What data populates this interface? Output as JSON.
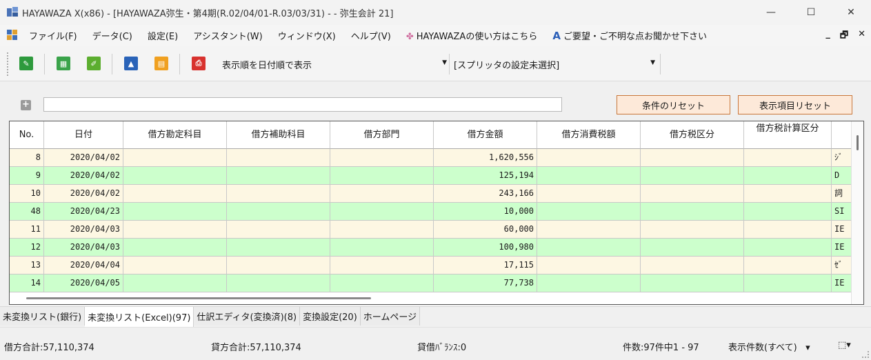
{
  "window": {
    "title": "HAYAWAZA X(x86) - [HAYAWAZA弥生・第4期(R.02/04/01-R.03/03/31) -  - 弥生会計 21]",
    "minimize": "—",
    "maximize": "☐",
    "close": "✕"
  },
  "menu": {
    "items": [
      "ファイル(F)",
      "データ(C)",
      "設定(E)",
      "アシスタント(W)",
      "ウィンドウ(X)",
      "ヘルプ(V)"
    ],
    "howto": "HAYAWAZAの使い方はこちら",
    "feedback": "ご要望・ご不明な点お聞かせ下さい",
    "mdi_min": "_",
    "mdi_restore": "🗗",
    "mdi_close": "✕"
  },
  "toolbar": {
    "sort_select": "表示順を日付順で表示",
    "splitter_select": "[スプリッタの設定未選択]",
    "icons": [
      "new-doc-icon",
      "spreadsheet-icon",
      "edit-icon",
      "upload-icon",
      "document-icon",
      "excel-export-icon"
    ]
  },
  "filter": {
    "expand": "+",
    "value": "",
    "reset_conditions": "条件のリセット",
    "reset_columns": "表示項目リセット"
  },
  "table": {
    "headers": [
      "No.",
      "日付",
      "借方勘定科目",
      "借方補助科目",
      "借方部門",
      "借方金額",
      "借方消費税額",
      "借方税区分",
      "借方税計算区分",
      ""
    ],
    "rows": [
      {
        "no": "8",
        "date": "2020/04/02",
        "amount": "1,620,556",
        "extra": "ｼﾞ"
      },
      {
        "no": "9",
        "date": "2020/04/02",
        "amount": "125,194",
        "extra": "D"
      },
      {
        "no": "10",
        "date": "2020/04/02",
        "amount": "243,166",
        "extra": "詞"
      },
      {
        "no": "48",
        "date": "2020/04/23",
        "amount": "10,000",
        "extra": "SI"
      },
      {
        "no": "11",
        "date": "2020/04/03",
        "amount": "60,000",
        "extra": "IE"
      },
      {
        "no": "12",
        "date": "2020/04/03",
        "amount": "100,980",
        "extra": "IE"
      },
      {
        "no": "13",
        "date": "2020/04/04",
        "amount": "17,115",
        "extra": "ｾﾞ"
      },
      {
        "no": "14",
        "date": "2020/04/05",
        "amount": "77,738",
        "extra": "IE"
      }
    ]
  },
  "tabs": [
    "未変換リスト(銀行)",
    "未変換リスト(Excel)(97)",
    "仕訳エディタ(変換済)(8)",
    "変換設定(20)",
    "ホームページ"
  ],
  "status": {
    "debit_total": "借方合計:57,110,374",
    "credit_total": "貸方合計:57,110,374",
    "balance": "貸借ﾊﾞﾗﾝｽ:0",
    "count": "件数:97件中1 - 97",
    "display_count": "表示件数(すべて)",
    "dropdown": "▾",
    "layout_icon": "⬚▾"
  }
}
